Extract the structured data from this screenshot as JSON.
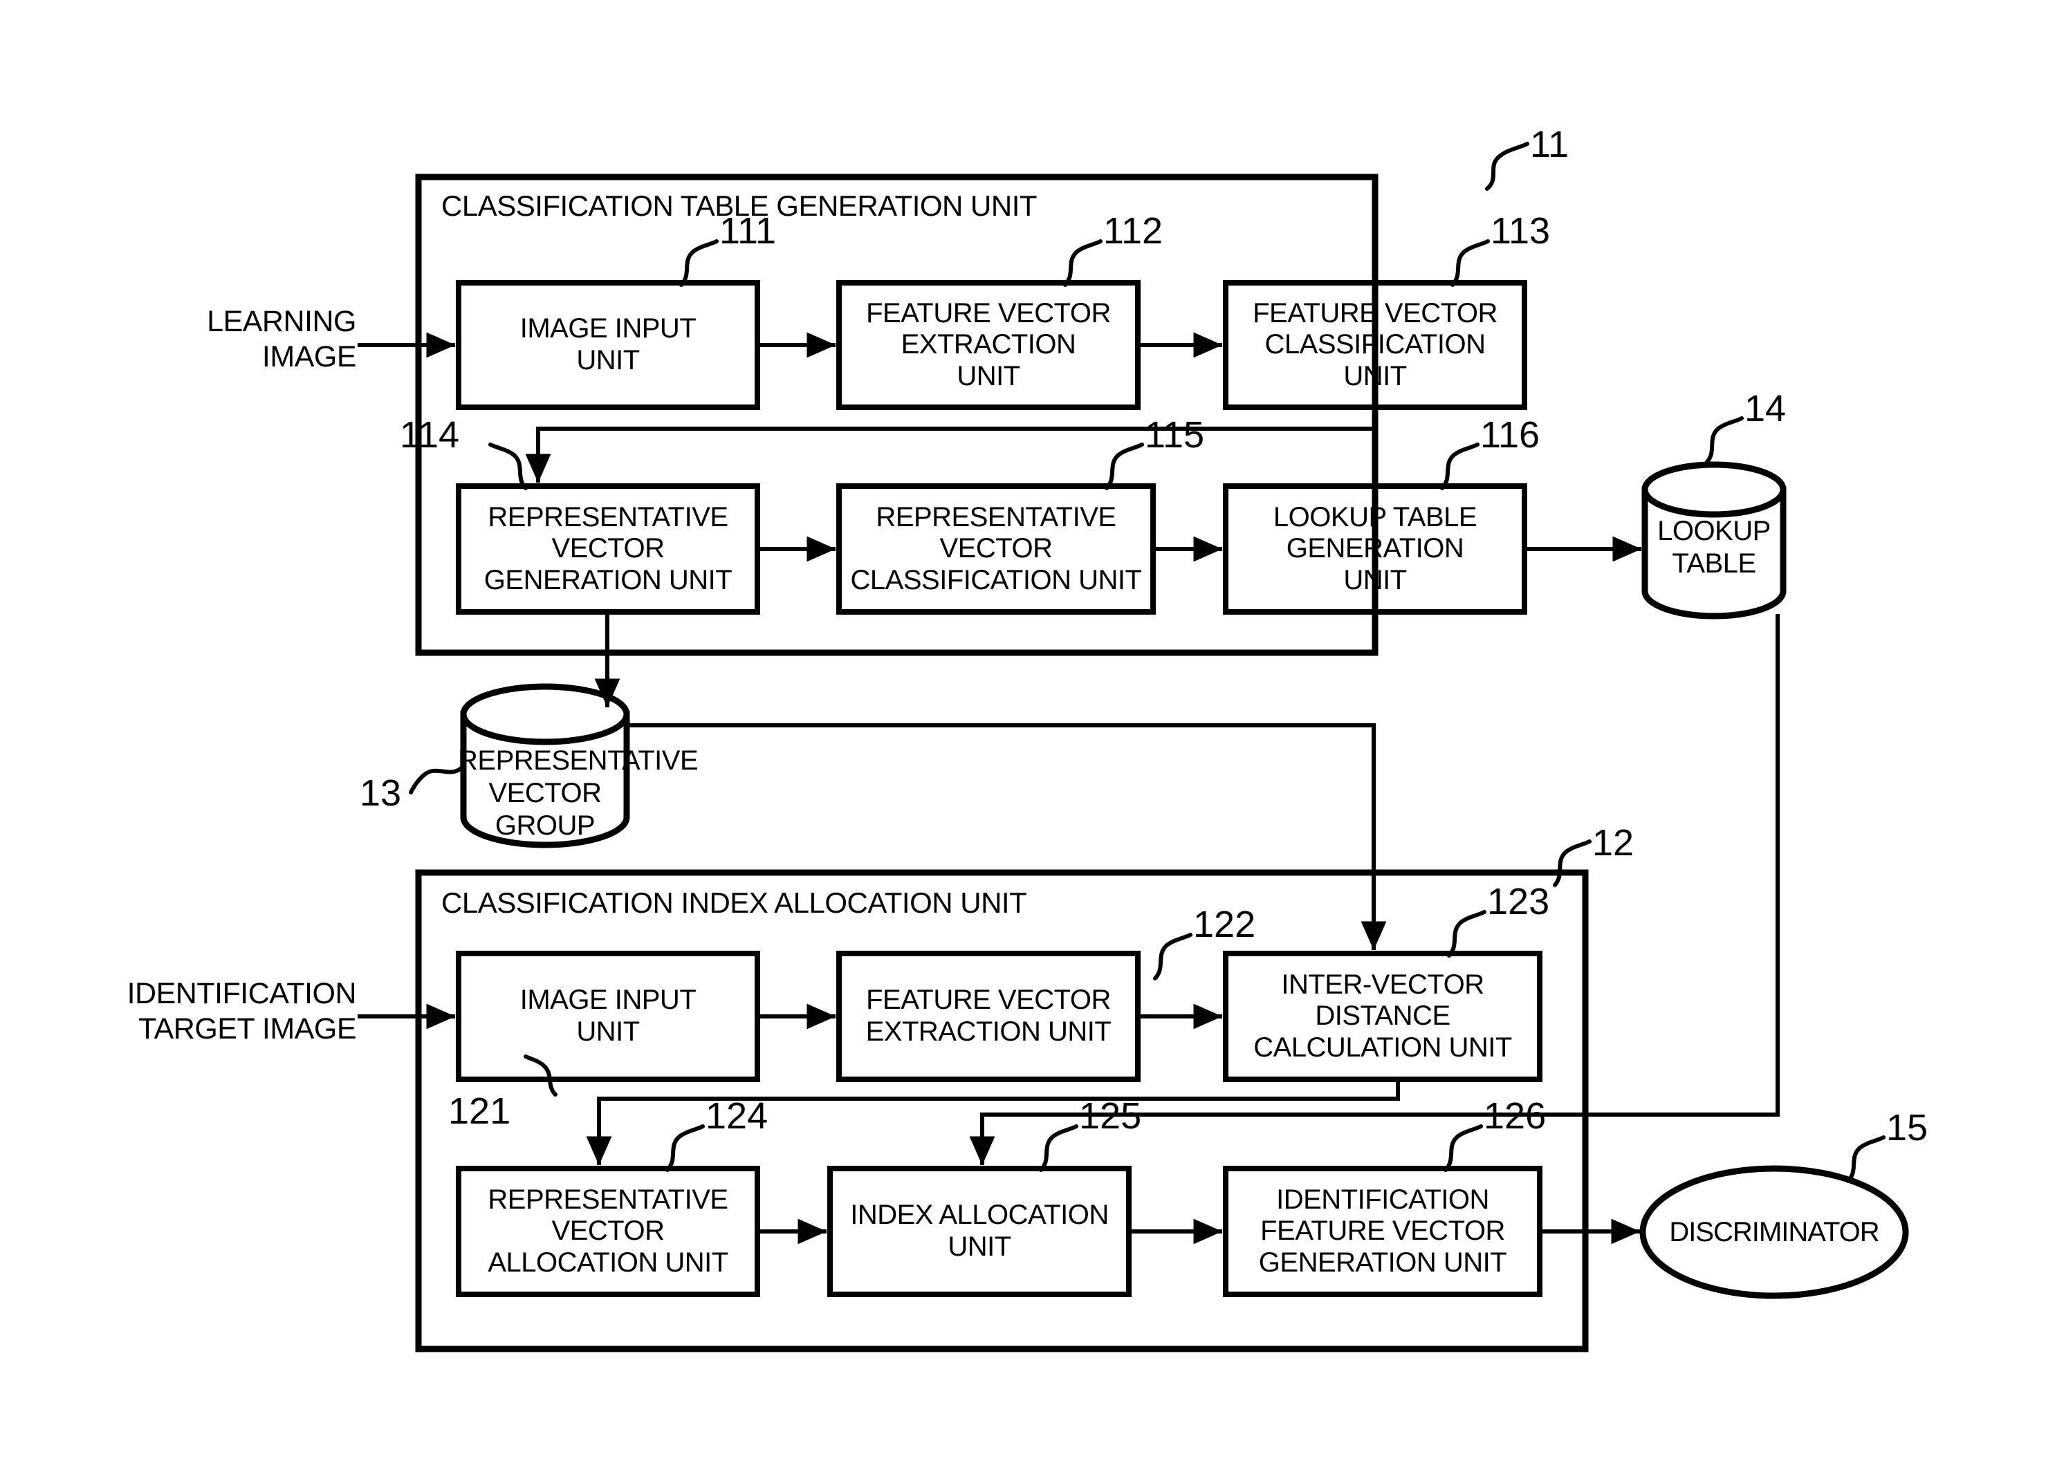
{
  "figure": {
    "type": "patent-block-diagram",
    "background": "#ffffff",
    "stroke": "#000000"
  },
  "inputs": {
    "learning_image": "LEARNING\nIMAGE",
    "identification_target_image": "IDENTIFICATION\nTARGET IMAGE"
  },
  "sections": {
    "unit11": {
      "ref": "11",
      "title": "CLASSIFICATION TABLE GENERATION UNIT",
      "blocks": [
        {
          "ref": "111",
          "label": "IMAGE INPUT\nUNIT"
        },
        {
          "ref": "112",
          "label": "FEATURE VECTOR\nEXTRACTION\nUNIT"
        },
        {
          "ref": "113",
          "label": "FEATURE VECTOR\nCLASSIFICATION\nUNIT"
        },
        {
          "ref": "114",
          "label": "REPRESENTATIVE\nVECTOR\nGENERATION UNIT"
        },
        {
          "ref": "115",
          "label": "REPRESENTATIVE\nVECTOR\nCLASSIFICATION UNIT"
        },
        {
          "ref": "116",
          "label": "LOOKUP TABLE\nGENERATION\nUNIT"
        }
      ]
    },
    "unit12": {
      "ref": "12",
      "title": "CLASSIFICATION INDEX ALLOCATION UNIT",
      "blocks": [
        {
          "ref": "121",
          "label": "IMAGE INPUT\nUNIT"
        },
        {
          "ref": "122",
          "label": "FEATURE VECTOR\nEXTRACTION UNIT"
        },
        {
          "ref": "123",
          "label": "INTER-VECTOR\nDISTANCE\nCALCULATION UNIT"
        },
        {
          "ref": "124",
          "label": "REPRESENTATIVE\nVECTOR\nALLOCATION UNIT"
        },
        {
          "ref": "125",
          "label": "INDEX ALLOCATION\nUNIT"
        },
        {
          "ref": "126",
          "label": "IDENTIFICATION\nFEATURE VECTOR\nGENERATION UNIT"
        }
      ]
    }
  },
  "stores": {
    "lookup_table": {
      "ref": "14",
      "label": "LOOKUP\nTABLE"
    },
    "representative_vector_group": {
      "ref": "13",
      "label": "REPRESENTATIVE\nVECTOR GROUP"
    }
  },
  "terminals": {
    "discriminator": {
      "ref": "15",
      "label": "DISCRIMINATOR"
    }
  }
}
